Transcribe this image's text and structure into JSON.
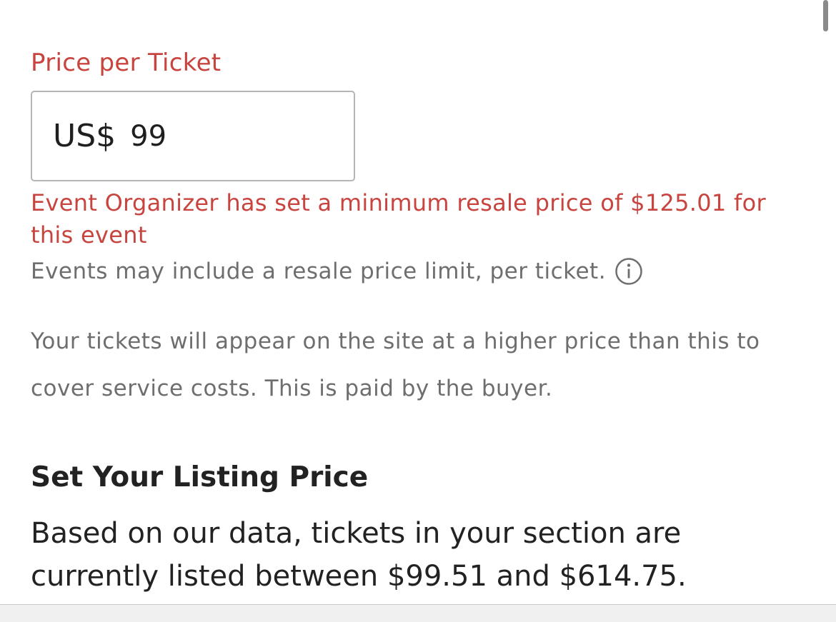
{
  "price_section": {
    "label": "Price per Ticket",
    "currency": "US$",
    "value": "99",
    "error": "Event Organizer has set a minimum resale price of $125.01 for this event",
    "hint": "Events may include a resale price limit, per ticket.",
    "info_icon": "info-circle-icon",
    "service_note": "Your tickets will appear on the site at a higher price than this to cover service costs. This is paid by the buyer."
  },
  "listing_section": {
    "title": "Set Your Listing Price",
    "description": "Based on our data, tickets in your section are currently listed between $99.51 and $614.75."
  },
  "colors": {
    "error": "#c8443f",
    "muted": "#6e6e6e",
    "text": "#222222"
  }
}
